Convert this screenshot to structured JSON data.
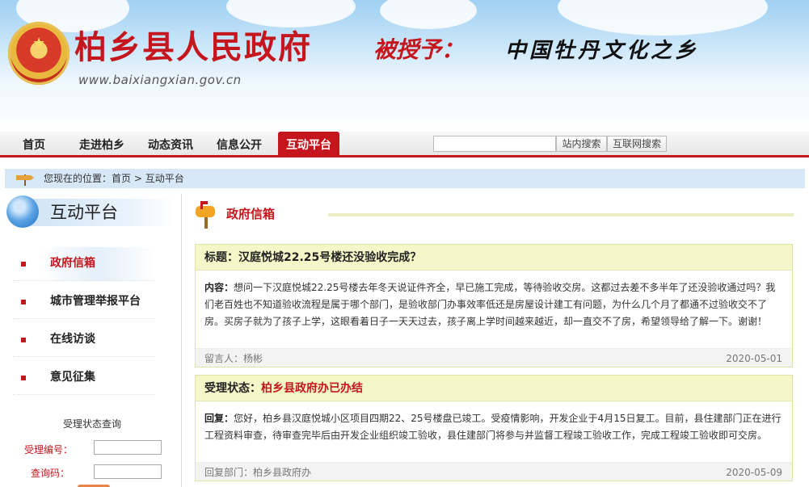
{
  "header": {
    "site_name": "柏乡县人民政府",
    "slogan_red": "被授予：",
    "slogan_black": "中国牡丹文化之乡",
    "site_url": "www.baixiangxian.gov.cn"
  },
  "nav": {
    "items": [
      "首页",
      "走进柏乡",
      "动态资讯",
      "信息公开",
      "互动平台"
    ],
    "active_index": 4,
    "search_placeholder": "",
    "search_site_label": "站内搜索",
    "search_web_label": "互联网搜索"
  },
  "breadcrumb": {
    "prefix": "您现在的位置：",
    "home": "首页",
    "separator": " > ",
    "current": "互动平台"
  },
  "sidebar": {
    "title": "互动平台",
    "items": [
      {
        "label": "政府信箱"
      },
      {
        "label": "城市管理举报平台"
      },
      {
        "label": "在线访谈"
      },
      {
        "label": "意见征集"
      }
    ],
    "active_index": 0,
    "query": {
      "title": "受理状态查询",
      "id_label": "受理编号：",
      "code_label": "查询码："
    }
  },
  "main": {
    "section_title": "政府信箱",
    "letter": {
      "title_label": "标题：",
      "title": "汉庭悦城22.25号楼还没验收完成？",
      "content_label": "内容：",
      "content": "想问一下汉庭悦城22.25号楼去年冬天说证件齐全，早已施工完成，等待验收交房。这都过去差不多半年了还没验收通过吗？我们老百姓也不知道验收流程是属于哪个部门，是验收部门办事效率低还是房屋设计建工有问题，为什么几个月了都通不过验收交不了房。买房子就为了孩子上学，这眼看着日子一天天过去，孩子离上学时间越来越近，却一直交不了房，希望领导给了解一下。谢谢！",
      "author_label": "留言人：",
      "author": "杨彬",
      "date": "2020-05-01"
    },
    "reply": {
      "status_label": "受理状态：",
      "status": "柏乡县政府办已办结",
      "reply_label": "回复：",
      "content": "您好，柏乡县汉庭悦城小区项目四期22、25号楼盘已竣工。受疫情影响，开发企业于4月15日复工。目前，县住建部门正在进行工程资料审查，待审查完毕后由开发企业组织竣工验收，县住建部门将参与并监督工程竣工验收工作，完成工程竣工验收即可交房。",
      "dept_label": "回复部门：",
      "dept": "柏乡县政府办",
      "date": "2020-05-09"
    }
  },
  "colors": {
    "brand_red": "#c4161c",
    "card_header_bg": "#f4f8c9",
    "crumb_bg": "#d6e7f7"
  }
}
